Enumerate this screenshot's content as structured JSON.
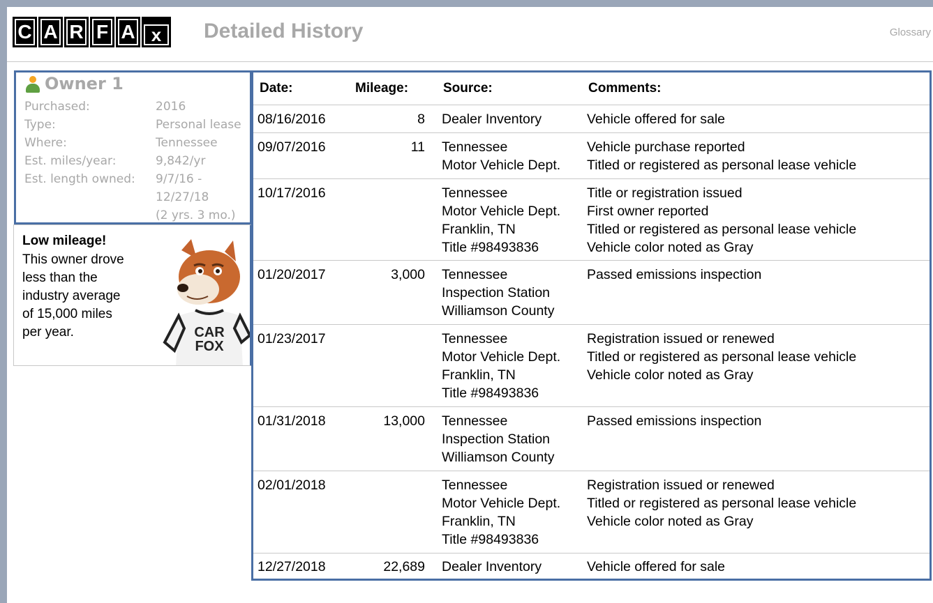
{
  "header": {
    "logo_letters": [
      "C",
      "A",
      "R",
      "F",
      "A"
    ],
    "logo_x": "x",
    "title": "Detailed History",
    "glossary_link": "Glossary"
  },
  "owner": {
    "title": "Owner 1",
    "icon": "person-icon",
    "facts": [
      {
        "label": "Purchased:",
        "value": "2016"
      },
      {
        "label": "Type:",
        "value": "Personal lease"
      },
      {
        "label": "Where:",
        "value": "Tennessee"
      },
      {
        "label": "Est. miles/year:",
        "value": "9,842/yr"
      },
      {
        "label": "Est. length owned:",
        "value": [
          "9/7/16 -",
          "12/27/18",
          "(2 yrs. 3 mo.)"
        ]
      }
    ]
  },
  "callout": {
    "heading": "Low mileage!",
    "lines": [
      "This owner drove",
      "less than the",
      "industry average",
      "of 15,000 miles",
      "per year."
    ],
    "fox_shirt": [
      "CAR",
      "FOX"
    ]
  },
  "history": {
    "columns": [
      "Date:",
      "Mileage:",
      "Source:",
      "Comments:"
    ],
    "rows": [
      {
        "date": "08/16/2016",
        "mileage": "8",
        "source": [
          "Dealer Inventory"
        ],
        "comments": [
          "Vehicle offered for sale"
        ]
      },
      {
        "date": "09/07/2016",
        "mileage": "11",
        "source": [
          "Tennessee",
          "Motor Vehicle Dept."
        ],
        "comments": [
          "Vehicle purchase reported",
          "Titled or registered as personal lease vehicle"
        ]
      },
      {
        "date": "10/17/2016",
        "mileage": "",
        "source": [
          "Tennessee",
          "Motor Vehicle Dept.",
          "Franklin, TN",
          "Title #98493836"
        ],
        "comments": [
          "Title or registration issued",
          "First owner reported",
          "Titled or registered as personal lease vehicle",
          "Vehicle color noted as Gray"
        ]
      },
      {
        "date": "01/20/2017",
        "mileage": "3,000",
        "source": [
          "Tennessee",
          "Inspection Station",
          "Williamson County"
        ],
        "comments": [
          "Passed emissions inspection"
        ]
      },
      {
        "date": "01/23/2017",
        "mileage": "",
        "source": [
          "Tennessee",
          "Motor Vehicle Dept.",
          "Franklin, TN",
          "Title #98493836"
        ],
        "comments": [
          "Registration issued or renewed",
          "Titled or registered as personal lease vehicle",
          "Vehicle color noted as Gray"
        ]
      },
      {
        "date": "01/31/2018",
        "mileage": "13,000",
        "source": [
          "Tennessee",
          "Inspection Station",
          "Williamson County"
        ],
        "comments": [
          "Passed emissions inspection"
        ]
      },
      {
        "date": "02/01/2018",
        "mileage": "",
        "source": [
          "Tennessee",
          "Motor Vehicle Dept.",
          "Franklin, TN",
          "Title #98493836"
        ],
        "comments": [
          "Registration issued or renewed",
          "Titled or registered as personal lease vehicle",
          "Vehicle color noted as Gray"
        ]
      },
      {
        "date": "12/27/2018",
        "mileage": "22,689",
        "source": [
          "Dealer Inventory"
        ],
        "comments": [
          "Vehicle offered for sale"
        ]
      }
    ]
  },
  "colors": {
    "frame": "#9aa6b8",
    "box_border": "#4a6fa5",
    "muted_text": "#a8a8a8",
    "rule": "#c8c8c8"
  }
}
